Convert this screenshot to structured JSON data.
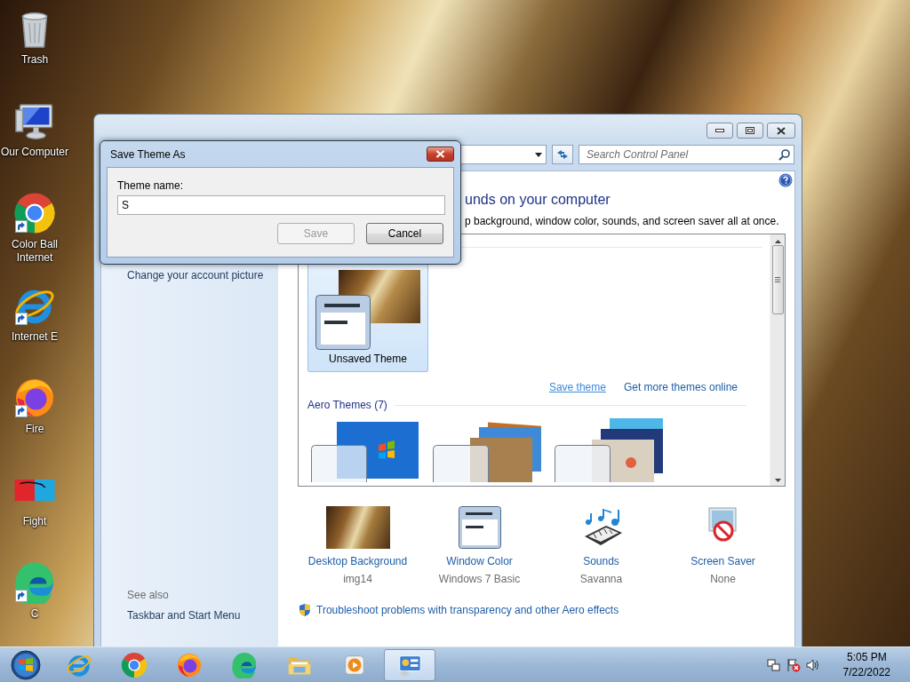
{
  "desktop_icons": [
    {
      "label": "Trash",
      "kind": "trash",
      "shortcut": false
    },
    {
      "label": "Our Computer",
      "kind": "computer",
      "shortcut": false
    },
    {
      "label": "Color Ball Internet",
      "kind": "chrome",
      "shortcut": true
    },
    {
      "label": "Internet E",
      "kind": "ie",
      "shortcut": true
    },
    {
      "label": "Fire",
      "kind": "firefox",
      "shortcut": true
    },
    {
      "label": "Fight",
      "kind": "game",
      "shortcut": false
    },
    {
      "label": "C",
      "kind": "edge",
      "shortcut": true
    }
  ],
  "window": {
    "search": {
      "placeholder": "Search Control Panel"
    },
    "sidebar": {
      "items": [
        "Change your account picture"
      ],
      "see_also_title": "See also",
      "see_also": [
        "Taskbar and Start Menu"
      ]
    },
    "heading": "unds on your computer",
    "subheading": "p background, window color, sounds, and screen saver all at once.",
    "themes": {
      "my_themes": [
        {
          "label": "Unsaved Theme",
          "selected": true
        }
      ],
      "links": [
        {
          "label": "Save theme",
          "hover": true
        },
        {
          "label": "Get more themes online",
          "hover": false
        }
      ],
      "aero_title": "Aero Themes (7)"
    },
    "settings": [
      {
        "kind": "photo",
        "label": "Desktop Background",
        "value": "img14"
      },
      {
        "kind": "window",
        "label": "Window Color",
        "value": "Windows 7 Basic"
      },
      {
        "kind": "sounds",
        "label": "Sounds",
        "value": "Savanna"
      },
      {
        "kind": "screensaver",
        "label": "Screen Saver",
        "value": "None"
      }
    ],
    "troubleshoot": "Troubleshoot problems with transparency and other Aero effects"
  },
  "dialog": {
    "title": "Save Theme As",
    "label": "Theme name:",
    "value": "S",
    "buttons": [
      {
        "label": "Save",
        "disabled": true
      },
      {
        "label": "Cancel",
        "disabled": false
      }
    ]
  },
  "taskbar": {
    "apps": [
      {
        "kind": "ie",
        "active": false
      },
      {
        "kind": "chrome",
        "active": false
      },
      {
        "kind": "firefox",
        "active": false
      },
      {
        "kind": "edge",
        "active": false
      },
      {
        "kind": "folder",
        "active": false
      },
      {
        "kind": "media",
        "active": false
      },
      {
        "kind": "control-panel",
        "active": true
      }
    ],
    "time": "5:05 PM",
    "date": "7/22/2022"
  }
}
